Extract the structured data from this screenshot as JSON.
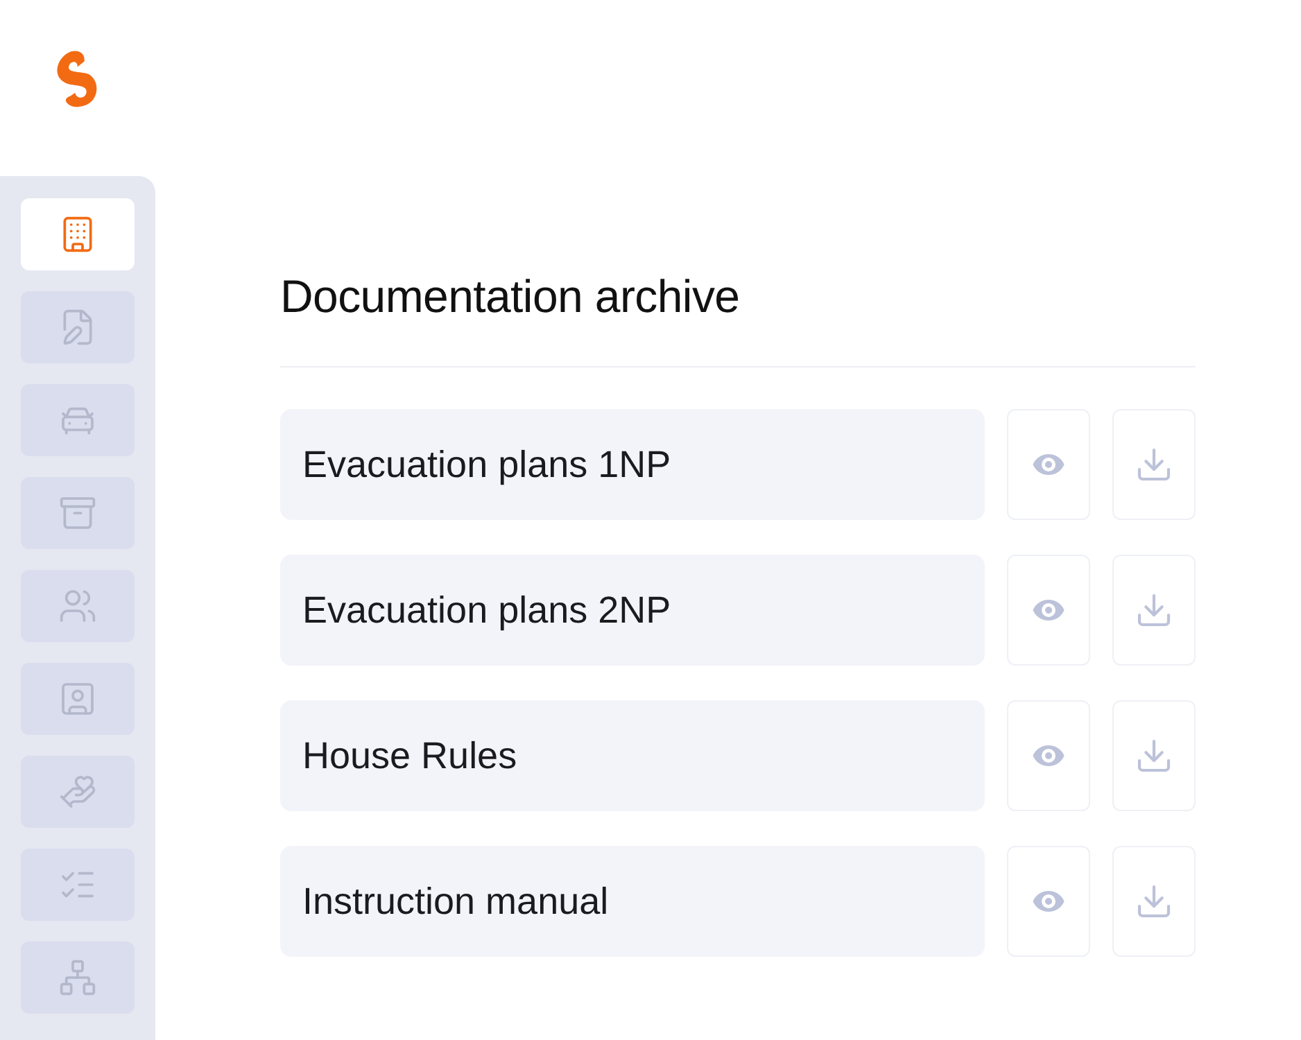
{
  "sidebar": {
    "items": [
      {
        "kind": "building",
        "selected": true
      },
      {
        "kind": "file-pen",
        "selected": false
      },
      {
        "kind": "car",
        "selected": false
      },
      {
        "kind": "archive",
        "selected": false
      },
      {
        "kind": "users",
        "selected": false
      },
      {
        "kind": "user-square",
        "selected": false
      },
      {
        "kind": "hand-file",
        "selected": false
      },
      {
        "kind": "checklist",
        "selected": false
      },
      {
        "kind": "network",
        "selected": false
      }
    ]
  },
  "main": {
    "title": "Documentation archive",
    "documents": [
      {
        "name": "Evacuation plans 1NP"
      },
      {
        "name": "Evacuation plans 2NP"
      },
      {
        "name": "House Rules"
      },
      {
        "name": "Instruction manual"
      }
    ]
  }
}
